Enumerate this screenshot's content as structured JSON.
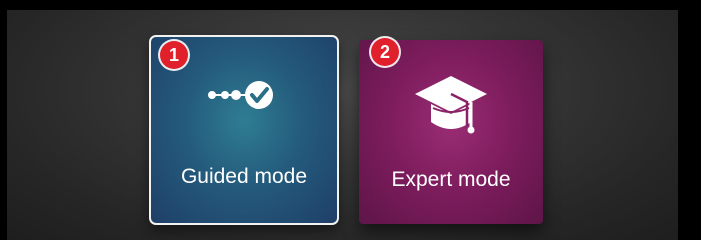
{
  "modes": [
    {
      "badge": "1",
      "label": "Guided mode",
      "icon": "steps-check-icon",
      "color": "#245b7c",
      "selected": true
    },
    {
      "badge": "2",
      "label": "Expert mode",
      "icon": "graduation-cap-icon",
      "color": "#7c1c5c",
      "selected": false
    }
  ],
  "colors": {
    "badge": "#e0202a",
    "background": "#353535"
  }
}
